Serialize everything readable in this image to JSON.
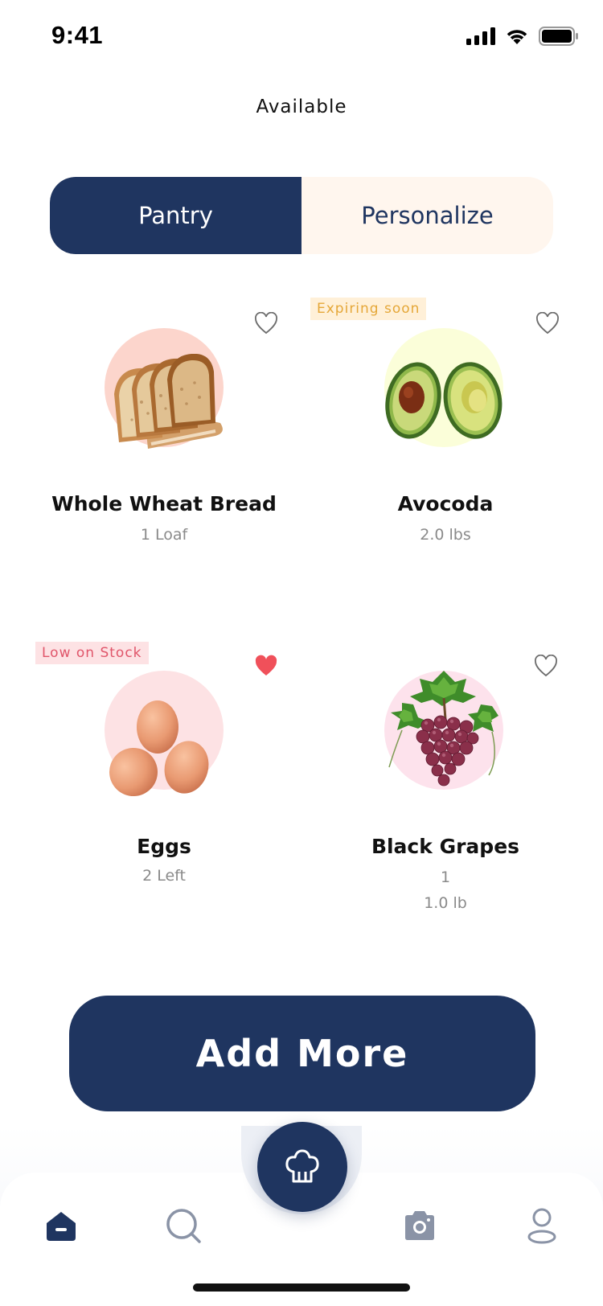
{
  "status_bar": {
    "time": "9:41",
    "icons": [
      "signal-icon",
      "wifi-icon",
      "battery-icon"
    ]
  },
  "header": {
    "title": "Available"
  },
  "tabs": [
    {
      "label": "Pantry",
      "active": true
    },
    {
      "label": "Personalize",
      "active": false
    }
  ],
  "items": [
    {
      "name": "Whole Wheat Bread",
      "qty": "1 Loaf",
      "qty2": "",
      "tag": "",
      "favorite": false,
      "image": "bread-image",
      "circle_color": "#fcd5cc"
    },
    {
      "name": "Avocoda",
      "qty": "2.0 lbs",
      "qty2": "",
      "tag": "Expiring soon",
      "favorite": false,
      "image": "avocado-image",
      "circle_color": "#fbfed9"
    },
    {
      "name": "Eggs",
      "qty": "2  Left",
      "qty2": "",
      "tag": "Low on Stock",
      "favorite": true,
      "image": "eggs-image",
      "circle_color": "#fde2e4"
    },
    {
      "name": "Black Grapes",
      "qty": "1",
      "qty2": "1.0 lb",
      "tag": "",
      "favorite": false,
      "image": "grapes-image",
      "circle_color": "#fde2ec"
    }
  ],
  "actions": {
    "add_more": "Add More"
  },
  "nav": {
    "items": [
      "home-icon",
      "search-icon",
      "chef-hat-icon",
      "camera-icon",
      "profile-icon"
    ],
    "active": "home-icon"
  },
  "colors": {
    "primary": "#1f3560",
    "tab_inactive_bg": "#fff6ee",
    "expiring": "#e5a738",
    "low_stock": "#e0556a",
    "favorite": "#f0505a"
  }
}
